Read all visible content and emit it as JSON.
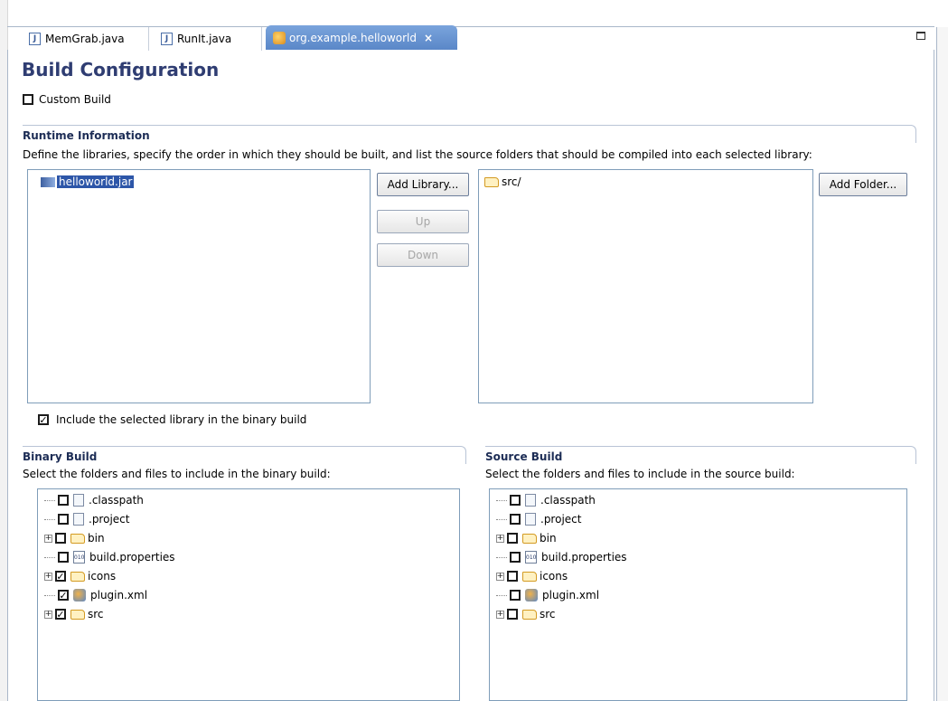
{
  "tabs": [
    {
      "label": "MemGrab.java",
      "icon": "java-file-icon",
      "active": false
    },
    {
      "label": "RunIt.java",
      "icon": "java-file-icon",
      "active": false
    },
    {
      "label": "org.example.helloworld",
      "icon": "plugin-icon",
      "active": true,
      "close": "×"
    }
  ],
  "page": {
    "title": "Build Configuration",
    "custom_build_label": "Custom Build"
  },
  "runtime": {
    "heading": "Runtime Information",
    "description": "Define the libraries, specify the order in which they should be built, and list the source folders that should be compiled into each selected library:",
    "library": "helloworld.jar",
    "folder": "src/",
    "add_library": "Add Library...",
    "up": "Up",
    "down": "Down",
    "add_folder": "Add Folder...",
    "include_label": "Include the selected library in the binary build"
  },
  "binary": {
    "heading": "Binary Build",
    "description": "Select the folders and files to include in the binary build:",
    "items": [
      {
        "label": ".classpath",
        "type": "file",
        "checked": false,
        "expandable": false
      },
      {
        "label": ".project",
        "type": "file",
        "checked": false,
        "expandable": false
      },
      {
        "label": "bin",
        "type": "folder",
        "checked": false,
        "expandable": true
      },
      {
        "label": "build.properties",
        "type": "props",
        "checked": false,
        "expandable": false
      },
      {
        "label": "icons",
        "type": "folder",
        "checked": true,
        "expandable": true
      },
      {
        "label": "plugin.xml",
        "type": "xml",
        "checked": true,
        "expandable": false
      },
      {
        "label": "src",
        "type": "folder",
        "checked": true,
        "expandable": true
      }
    ]
  },
  "source": {
    "heading": "Source Build",
    "description": "Select the folders and files to include in the source build:",
    "items": [
      {
        "label": ".classpath",
        "type": "file",
        "checked": false,
        "expandable": false
      },
      {
        "label": ".project",
        "type": "file",
        "checked": false,
        "expandable": false
      },
      {
        "label": "bin",
        "type": "folder",
        "checked": false,
        "expandable": true
      },
      {
        "label": "build.properties",
        "type": "props",
        "checked": false,
        "expandable": false
      },
      {
        "label": "icons",
        "type": "folder",
        "checked": false,
        "expandable": true
      },
      {
        "label": "plugin.xml",
        "type": "xml",
        "checked": false,
        "expandable": false
      },
      {
        "label": "src",
        "type": "folder",
        "checked": false,
        "expandable": true
      }
    ]
  },
  "colors": {
    "title": "#2f3d72",
    "tab_active": "#5a87c8",
    "selection": "#2d56a8"
  }
}
